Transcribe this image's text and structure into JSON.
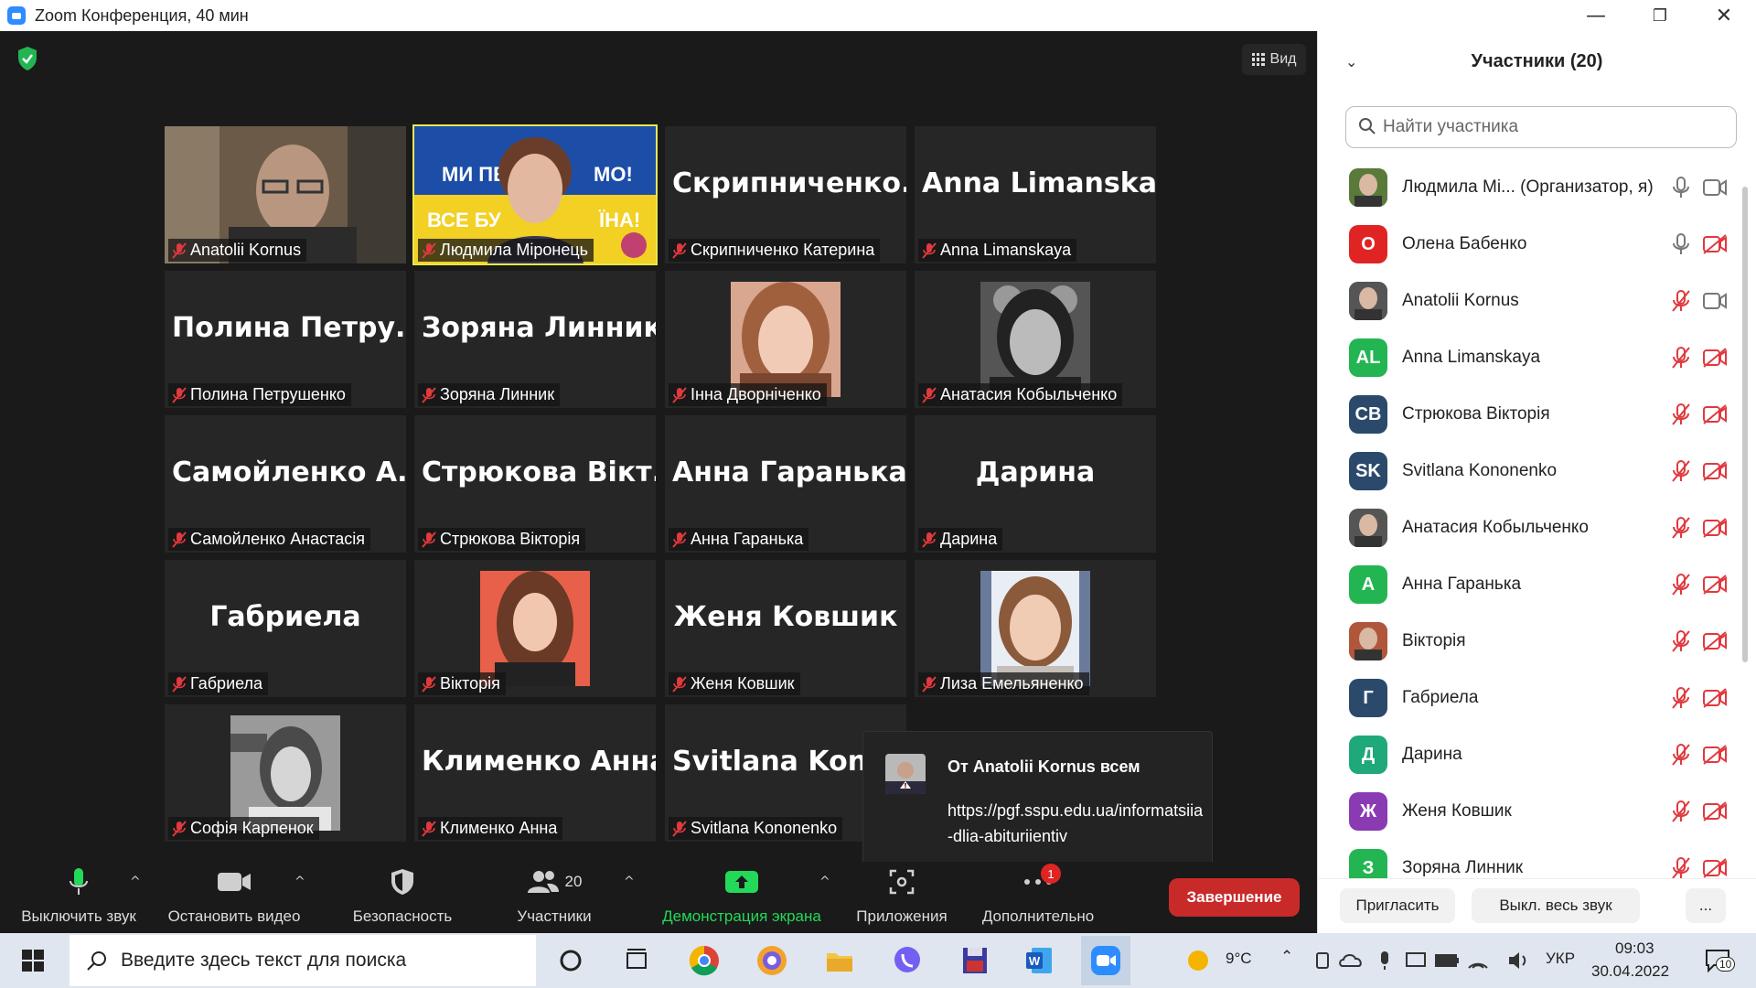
{
  "window": {
    "title": "Zoom Конференция, 40 мин",
    "minimize": "—",
    "restore": "❐",
    "close": "✕"
  },
  "view": {
    "label": "Вид"
  },
  "tiles": [
    {
      "big": "",
      "label": "Anatolii Kornus",
      "photo": "man"
    },
    {
      "big": "",
      "label": "Людмила Міронець",
      "photo": "host",
      "active": true
    },
    {
      "big": "Скрипниченко...",
      "label": "Скрипниченко Катерина"
    },
    {
      "big": "Anna Limanskaya",
      "label": "Anna Limanskaya"
    },
    {
      "big": "Полина  Петру...",
      "label": "Полина Петрушенко"
    },
    {
      "big": "Зоряна Линник",
      "label": "Зоряна Линник"
    },
    {
      "big": "",
      "label": "Інна Дворніченко",
      "photo": "girl1"
    },
    {
      "big": "",
      "label": "Анатасия Кобыльченко",
      "photo": "girl_bw"
    },
    {
      "big": "Самойленко  А...",
      "label": "Самойленко Анастасія"
    },
    {
      "big": "Стрюкова  Вікт...",
      "label": "Стрюкова Вікторія"
    },
    {
      "big": "Анна Гаранька",
      "label": "Анна Гаранька"
    },
    {
      "big": "Дарина",
      "label": "Дарина"
    },
    {
      "big": "Габриела",
      "label": "Габриела"
    },
    {
      "big": "",
      "label": "Вікторія",
      "photo": "girl_red"
    },
    {
      "big": "Женя Ковшик",
      "label": "Женя Ковшик"
    },
    {
      "big": "",
      "label": "Лиза Емельяненко",
      "photo": "girl2"
    },
    {
      "big": "",
      "label": "Софія Карпенок",
      "photo": "girl_bw2"
    },
    {
      "big": "Клименко Анна",
      "label": "Клименко Анна"
    },
    {
      "big": "Svitlana  Konon",
      "label": "Svitlana Kononenko"
    }
  ],
  "host_banner": {
    "line1": "МИ ПЕ",
    "line1b": "МО!",
    "line2": "ВСЕ БУ",
    "line2b": "ЇНА!"
  },
  "chat": {
    "from": "От Anatolii Kornus всем",
    "message": "https://pgf.sspu.edu.ua/informatsiia-dlia-abituriientiv"
  },
  "toolbar": {
    "mute": "Выключить звук",
    "video": "Остановить видео",
    "security": "Безопасность",
    "participants": "Участники",
    "participants_count": "20",
    "share": "Демонстрация экрана",
    "apps": "Приложения",
    "more": "Дополнительно",
    "more_badge": "1",
    "end": "Завершение",
    "caret": "^"
  },
  "panel": {
    "title": "Участники (20)",
    "search_placeholder": "Найти участника",
    "invite": "Пригласить",
    "mute_all": "Выкл. весь звук",
    "more": "...",
    "participants": [
      {
        "name": "Людмила Мі... (Организатор, я)",
        "avatar": "img",
        "color": "#5a7a3a",
        "mic": "on",
        "cam": "on"
      },
      {
        "name": "Олена Бабенко",
        "avatar": "О",
        "color": "#e02424",
        "mic": "on",
        "cam": "off"
      },
      {
        "name": "Anatolii Kornus",
        "avatar": "img",
        "color": "#555555",
        "mic": "off",
        "cam": "on"
      },
      {
        "name": "Anna Limanskaya",
        "avatar": "AL",
        "color": "#23b552",
        "mic": "off",
        "cam": "off"
      },
      {
        "name": "Стрюкова Вікторія",
        "avatar": "СВ",
        "color": "#2b4a6b",
        "mic": "off",
        "cam": "off"
      },
      {
        "name": "Svitlana Kononenko",
        "avatar": "SK",
        "color": "#2b4a6b",
        "mic": "off",
        "cam": "off"
      },
      {
        "name": "Анатасия Кобыльченко",
        "avatar": "img",
        "color": "#555555",
        "mic": "off",
        "cam": "off"
      },
      {
        "name": "Анна Гаранька",
        "avatar": "А",
        "color": "#23b552",
        "mic": "off",
        "cam": "off"
      },
      {
        "name": "Вікторія",
        "avatar": "img",
        "color": "#b0563a",
        "mic": "off",
        "cam": "off"
      },
      {
        "name": "Габриела",
        "avatar": "Г",
        "color": "#2b4a6b",
        "mic": "off",
        "cam": "off"
      },
      {
        "name": "Дарина",
        "avatar": "Д",
        "color": "#1fa87a",
        "mic": "off",
        "cam": "off"
      },
      {
        "name": "Женя Ковшик",
        "avatar": "Ж",
        "color": "#8a3ab3",
        "mic": "off",
        "cam": "off"
      },
      {
        "name": "Зоряна Линник",
        "avatar": "З",
        "color": "#23b552",
        "mic": "off",
        "cam": "off"
      }
    ]
  },
  "taskbar": {
    "search_placeholder": "Введите здесь текст для поиска",
    "temperature": "9°C",
    "language": "УКР",
    "time": "09:03",
    "date": "30.04.2022",
    "notifications": "10"
  },
  "colors": {
    "accent_green": "#23d959",
    "end_red": "#c82a2a",
    "active_border": "#e8e84a"
  }
}
